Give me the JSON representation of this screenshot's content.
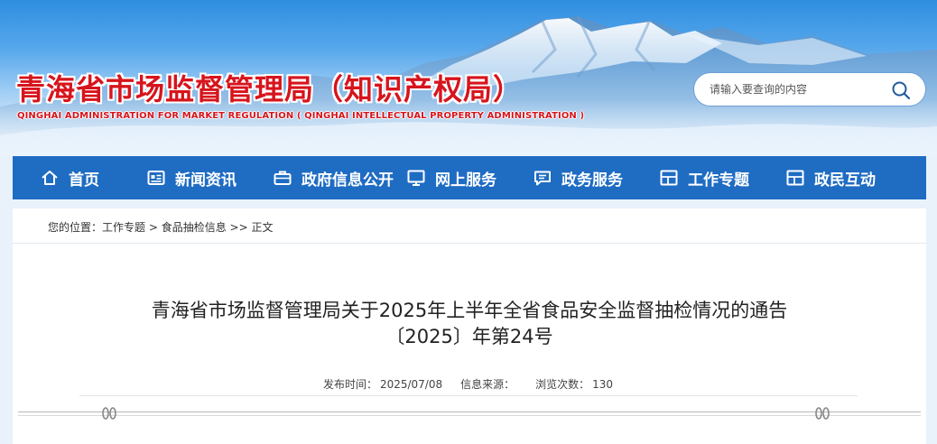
{
  "header": {
    "title": "青海省市场监督管理局（知识产权局）",
    "subtitle": "QINGHAI ADMINISTRATION FOR MARKET REGULATION ( QINGHAI INTELLECTUAL PROPERTY ADMINISTRATION )",
    "search_placeholder": "请输入要查询的内容"
  },
  "nav": [
    {
      "label": "首页",
      "icon": "home-icon"
    },
    {
      "label": "新闻资讯",
      "icon": "news-icon"
    },
    {
      "label": "政府信息公开",
      "icon": "briefcase-icon"
    },
    {
      "label": "网上服务",
      "icon": "monitor-icon"
    },
    {
      "label": "政务服务",
      "icon": "chat-icon"
    },
    {
      "label": "工作专题",
      "icon": "layout-icon"
    },
    {
      "label": "政民互动",
      "icon": "layout-icon"
    }
  ],
  "breadcrumb": {
    "prefix": "您的位置：",
    "items": [
      "工作专题",
      "食品抽检信息",
      "正文"
    ],
    "sep1": " > ",
    "sep2": " >> "
  },
  "article": {
    "title_line1": "青海省市场监督管理局关于2025年上半年全省食品安全监督抽检情况的通告",
    "title_line2": "〔2025〕年第24号",
    "publish_label": "发布时间：",
    "publish_date": "2025/07/08",
    "source_label": "信息来源：",
    "source_value": "",
    "views_label": "浏览次数：",
    "views_value": "130"
  },
  "colors": {
    "nav_bg": "#1f6cc3",
    "title_red": "#d7141c",
    "page_bg": "#e9f2fb"
  }
}
